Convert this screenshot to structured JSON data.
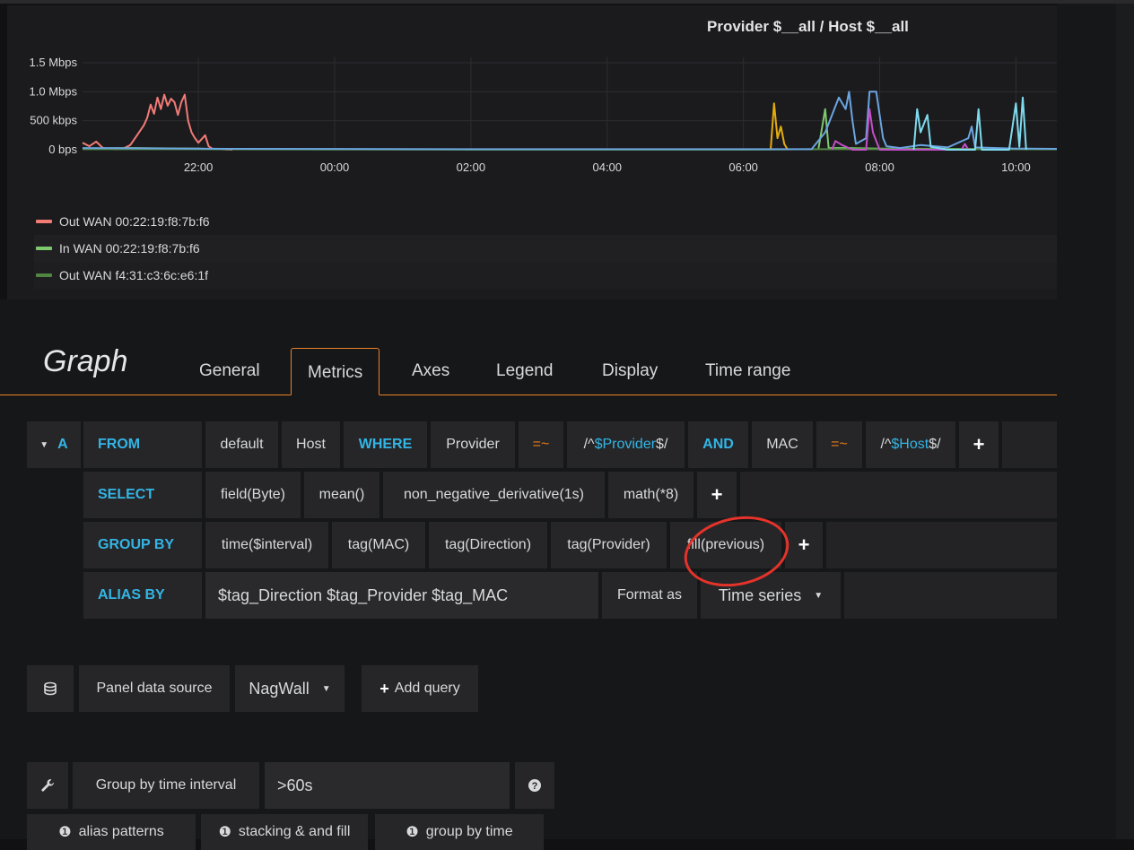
{
  "graph": {
    "title": "Provider $__all / Host $__all",
    "legend": [
      {
        "label": "Out WAN 00:22:19:f8:7b:f6",
        "color": "#f27b76"
      },
      {
        "label": "In WAN 00:22:19:f8:7b:f6",
        "color": "#7ec96e"
      },
      {
        "label": "Out WAN f4:31:c3:6c:e6:1f",
        "color": "#508642"
      }
    ]
  },
  "chart_data": {
    "type": "line",
    "title": "Provider $__all / Host $__all",
    "y_ticks": [
      "1.5 Mbps",
      "1.0 Mbps",
      "500 kbps",
      "0 bps"
    ],
    "x_ticks": [
      "22:00",
      "00:00",
      "02:00",
      "04:00",
      "06:00",
      "08:00",
      "10:00"
    ],
    "ylim_kbps": [
      0,
      1500
    ],
    "x_range_hours": [
      20.3,
      34.6
    ],
    "grid": true,
    "legend_placement": "bottom-left",
    "series": [
      {
        "name": "Out WAN 00:22:19:f8:7b:f6",
        "color": "#f27b76",
        "points": [
          [
            20.3,
            120
          ],
          [
            20.4,
            60
          ],
          [
            20.5,
            140
          ],
          [
            20.6,
            30
          ],
          [
            20.7,
            20
          ],
          [
            20.8,
            10
          ],
          [
            20.9,
            20
          ],
          [
            21.0,
            80
          ],
          [
            21.1,
            250
          ],
          [
            21.2,
            420
          ],
          [
            21.25,
            550
          ],
          [
            21.3,
            780
          ],
          [
            21.35,
            620
          ],
          [
            21.4,
            900
          ],
          [
            21.45,
            700
          ],
          [
            21.5,
            950
          ],
          [
            21.55,
            760
          ],
          [
            21.6,
            880
          ],
          [
            21.65,
            820
          ],
          [
            21.7,
            600
          ],
          [
            21.75,
            820
          ],
          [
            21.8,
            950
          ],
          [
            21.85,
            500
          ],
          [
            21.9,
            300
          ],
          [
            21.95,
            200
          ],
          [
            22.0,
            120
          ],
          [
            22.1,
            250
          ],
          [
            22.15,
            60
          ],
          [
            22.2,
            20
          ],
          [
            22.3,
            10
          ],
          [
            22.5,
            0
          ]
        ]
      },
      {
        "name": "In WAN 00:22:19:f8:7b:f6",
        "color": "#7ec96e",
        "points": [
          [
            20.3,
            20
          ],
          [
            21.0,
            30
          ],
          [
            22.0,
            20
          ],
          [
            22.3,
            10
          ],
          [
            26.0,
            5
          ],
          [
            30.0,
            5
          ],
          [
            31.1,
            10
          ],
          [
            31.2,
            700
          ],
          [
            31.25,
            30
          ],
          [
            31.5,
            30
          ],
          [
            32.0,
            20
          ],
          [
            34.6,
            10
          ]
        ]
      },
      {
        "name": "Out WAN f4:31:c3:6c:e6:1f",
        "color": "#508642",
        "points": [
          [
            20.3,
            10
          ],
          [
            22.0,
            10
          ],
          [
            24.0,
            5
          ],
          [
            26.0,
            5
          ],
          [
            28.0,
            5
          ],
          [
            30.0,
            5
          ],
          [
            31.0,
            10
          ],
          [
            34.6,
            10
          ]
        ]
      },
      {
        "color": "#e5ac0e",
        "points": [
          [
            30.4,
            0
          ],
          [
            30.45,
            800
          ],
          [
            30.5,
            200
          ],
          [
            30.55,
            400
          ],
          [
            30.6,
            100
          ],
          [
            30.65,
            0
          ]
        ]
      },
      {
        "color": "#6ba5e0",
        "points": [
          [
            20.3,
            30
          ],
          [
            22.5,
            15
          ],
          [
            26.0,
            10
          ],
          [
            30.0,
            10
          ],
          [
            31.0,
            10
          ],
          [
            31.2,
            300
          ],
          [
            31.3,
            600
          ],
          [
            31.4,
            900
          ],
          [
            31.5,
            700
          ],
          [
            31.55,
            1000
          ],
          [
            31.6,
            500
          ],
          [
            31.65,
            100
          ],
          [
            31.8,
            200
          ],
          [
            31.85,
            1000
          ],
          [
            31.95,
            1000
          ],
          [
            32.05,
            200
          ],
          [
            32.1,
            60
          ],
          [
            32.3,
            30
          ],
          [
            32.6,
            80
          ],
          [
            33.0,
            40
          ],
          [
            33.3,
            200
          ],
          [
            33.35,
            400
          ],
          [
            33.4,
            40
          ],
          [
            34.0,
            20
          ],
          [
            34.6,
            15
          ]
        ]
      },
      {
        "color": "#c250c7",
        "points": [
          [
            31.3,
            0
          ],
          [
            31.35,
            150
          ],
          [
            31.45,
            80
          ],
          [
            31.6,
            0
          ],
          [
            31.8,
            0
          ],
          [
            31.85,
            700
          ],
          [
            31.9,
            300
          ],
          [
            32.0,
            0
          ],
          [
            33.2,
            0
          ],
          [
            33.25,
            100
          ],
          [
            33.3,
            0
          ]
        ]
      },
      {
        "color": "#7edbee",
        "points": [
          [
            32.5,
            0
          ],
          [
            32.55,
            700
          ],
          [
            32.6,
            300
          ],
          [
            32.7,
            600
          ],
          [
            32.75,
            50
          ],
          [
            33.0,
            0
          ],
          [
            33.4,
            0
          ],
          [
            33.45,
            700
          ],
          [
            33.5,
            0
          ],
          [
            33.9,
            0
          ],
          [
            34.0,
            800
          ],
          [
            34.05,
            50
          ],
          [
            34.1,
            900
          ],
          [
            34.15,
            0
          ]
        ]
      }
    ]
  },
  "editor": {
    "title": "Graph",
    "tabs": [
      "General",
      "Metrics",
      "Axes",
      "Legend",
      "Display",
      "Time range"
    ],
    "active_tab": "Metrics",
    "query": {
      "ref_id": "A",
      "from_kw": "FROM",
      "policy": "default",
      "measurement": "Host",
      "where_kw": "WHERE",
      "where_key1": "Provider",
      "where_op1": "=~",
      "where_val1_prefix": "/^",
      "where_val1_var": "$Provider",
      "where_val1_suffix": "$/",
      "and_kw": "AND",
      "where_key2": "MAC",
      "where_op2": "=~",
      "where_val2_prefix": "/^",
      "where_val2_var": "$Host",
      "where_val2_suffix": "$/",
      "select_kw": "SELECT",
      "select_parts": [
        "field(Byte)",
        "mean()",
        "non_negative_derivative(1s)",
        "math(*8)"
      ],
      "group_kw": "GROUP BY",
      "group_parts": [
        "time($interval)",
        "tag(MAC)",
        "tag(Direction)",
        "tag(Provider)",
        "fill(previous)"
      ],
      "alias_kw": "ALIAS BY",
      "alias_value": "$tag_Direction $tag_Provider $tag_MAC",
      "format_label": "Format as",
      "format_value": "Time series"
    },
    "datasource": {
      "label": "Panel data source",
      "value": "NagWall",
      "add_query": "Add query"
    },
    "options": {
      "group_by_label": "Group by time interval",
      "group_by_value": ">60s",
      "help_links": [
        "alias patterns",
        "stacking & and fill",
        "group by time"
      ]
    }
  }
}
